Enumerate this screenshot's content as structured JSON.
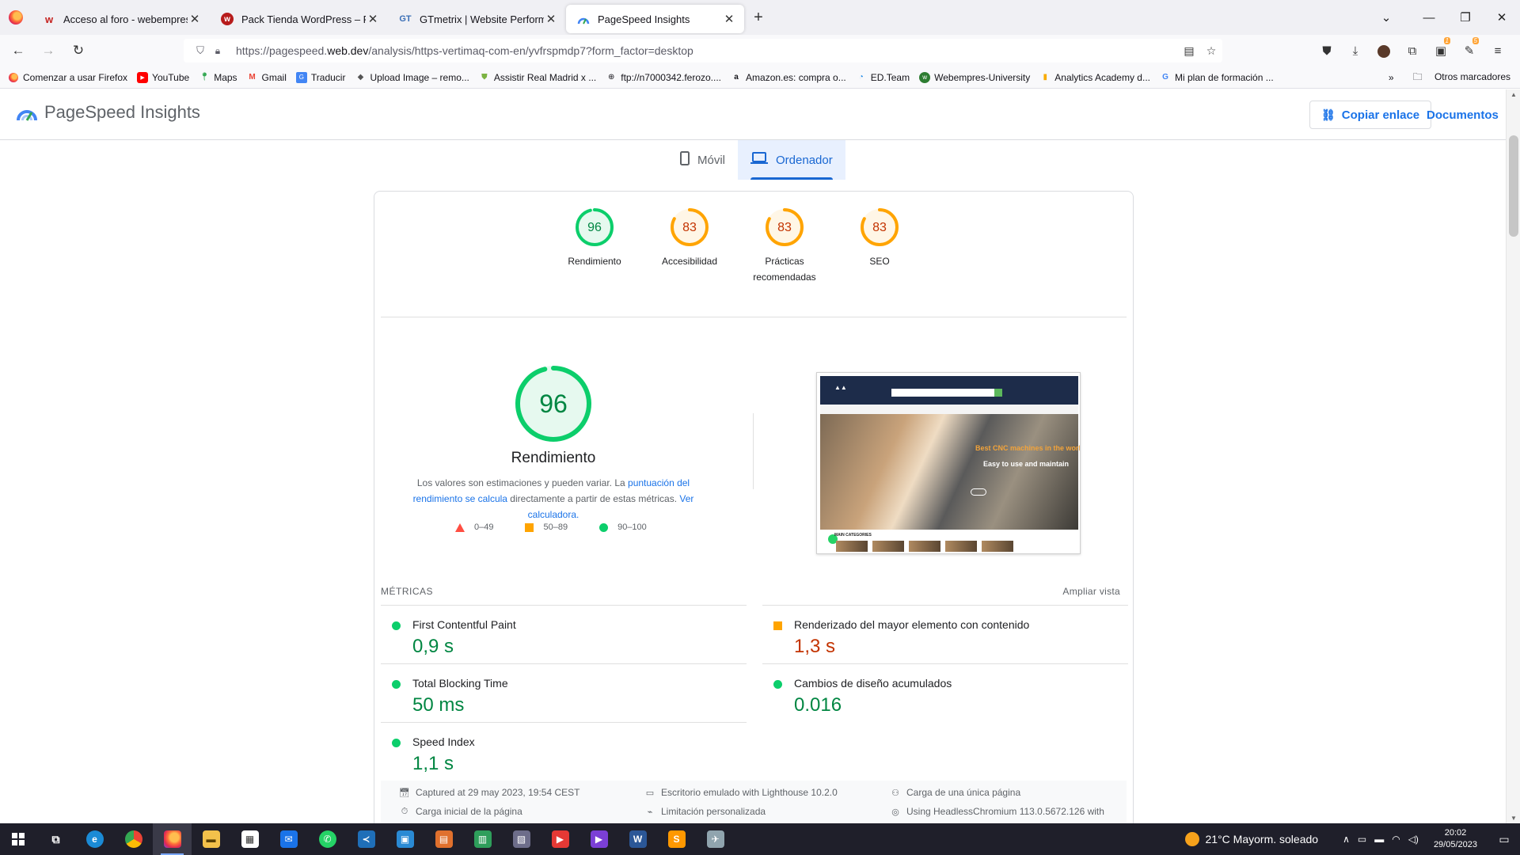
{
  "browser": {
    "tabs": [
      {
        "title": "Acceso al foro - webempresa.com",
        "active": false
      },
      {
        "title": "Pack Tienda WordPress – Foro Webempresa",
        "active": false
      },
      {
        "title": "GTmetrix | Website Performance Testing",
        "active": false
      },
      {
        "title": "PageSpeed Insights",
        "active": true
      }
    ],
    "url_prefix": "https://pagespeed.",
    "url_domain": "web.dev",
    "url_rest": "/analysis/https-vertimaq-com-en/yvfrspmdp7?form_factor=desktop",
    "bookmarks": [
      "Comenzar a usar Firefox",
      "YouTube",
      "Maps",
      "Gmail",
      "Traducir",
      "Upload Image – remo...",
      "Assistir Real Madrid x ...",
      "ftp://n7000342.ferozo....",
      "Amazon.es: compra o...",
      "ED.Team",
      "Webempres-University",
      "Analytics Academy  d...",
      "Mi plan de formación ..."
    ],
    "other_bookmarks": "Otros marcadores"
  },
  "header": {
    "title": "PageSpeed Insights",
    "copy_link": "Copiar enlace",
    "docs": "Documentos"
  },
  "device_tabs": {
    "mobile": "Móvil",
    "desktop": "Ordenador"
  },
  "scores": [
    {
      "value": "96",
      "label": "Rendimiento",
      "score": 96,
      "color": "#0cce6b",
      "text_color": "#018642",
      "bg": "#e6f9ef"
    },
    {
      "value": "83",
      "label": "Accesibilidad",
      "score": 83,
      "color": "#ffa400",
      "text_color": "#c33300",
      "bg": "#fff6e6"
    },
    {
      "value": "83",
      "label": "Prácticas recomendadas",
      "score": 83,
      "color": "#ffa400",
      "text_color": "#c33300",
      "bg": "#fff6e6"
    },
    {
      "value": "83",
      "label": "SEO",
      "score": 83,
      "color": "#ffa400",
      "text_color": "#c33300",
      "bg": "#fff6e6"
    }
  ],
  "performance": {
    "score": "96",
    "title": "Rendimiento",
    "desc_1": "Los valores son estimaciones y pueden variar. La ",
    "desc_link_1": "puntuación del rendimiento se calcula",
    "desc_2": " directamente a partir de estas métricas. ",
    "desc_link_2": "Ver calculadora.",
    "legend": [
      "0–49",
      "50–89",
      "90–100"
    ]
  },
  "screenshot": {
    "hero_line_1": "Best CNC machines in the world",
    "hero_line_2": "Easy to use and maintain",
    "categories": "MAIN CATEGORIES"
  },
  "metrics": {
    "heading": "MÉTRICAS",
    "expand": "Ampliar vista",
    "items": [
      {
        "name": "First Contentful Paint",
        "value": "0,9 s",
        "rating": "good"
      },
      {
        "name": "Renderizado del mayor elemento con contenido",
        "value": "1,3 s",
        "rating": "average"
      },
      {
        "name": "Total Blocking Time",
        "value": "50 ms",
        "rating": "good"
      },
      {
        "name": "Cambios de diseño acumulados",
        "value": "0.016",
        "rating": "good"
      },
      {
        "name": "Speed Index",
        "value": "1,1 s",
        "rating": "good"
      }
    ]
  },
  "runtime": {
    "captured": "Captured at 29 may 2023, 19:54 CEST",
    "emulated": "Escritorio emulado with Lighthouse 10.2.0",
    "single_load": "Carga de una única página",
    "initial_load": "Carga inicial de la página",
    "throttling": "Limitación personalizada",
    "browser": "Using HeadlessChromium 113.0.5672.126 with"
  },
  "taskbar": {
    "weather": "21°C  Mayorm. soleado",
    "time": "20:02",
    "date": "29/05/2023"
  }
}
